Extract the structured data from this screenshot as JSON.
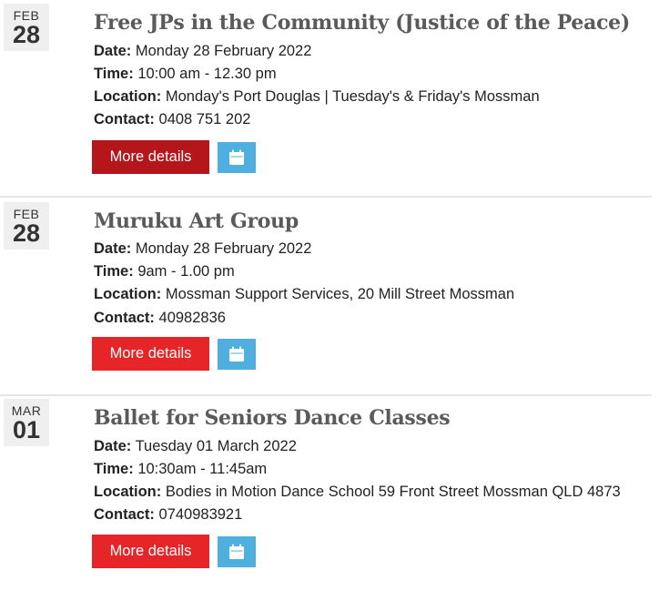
{
  "colors": {
    "button_active": "#b4161c",
    "button": "#e62529",
    "calendar_button": "#4fb0e0",
    "title": "#5a5a5a"
  },
  "events": [
    {
      "month": "FEB",
      "day": "28",
      "title": "Free JPs in the Community (Justice of the Peace)",
      "date_label": "Date:",
      "date": "Monday 28 February 2022",
      "time_label": "Time:",
      "time": "10:00 am - 12.30 pm",
      "location_label": "Location:",
      "location": "Monday's Port Douglas | Tuesday's & Friday's Mossman",
      "contact_label": "Contact:",
      "contact": "0408 751 202",
      "more_label": "More details",
      "calendar_icon": "calendar-icon"
    },
    {
      "month": "FEB",
      "day": "28",
      "title": "Muruku Art Group",
      "date_label": "Date:",
      "date": "Monday 28 February 2022",
      "time_label": "Time:",
      "time": "9am - 1.00 pm",
      "location_label": "Location:",
      "location": "Mossman Support Services, 20 Mill Street Mossman",
      "contact_label": "Contact:",
      "contact": "40982836",
      "more_label": "More details",
      "calendar_icon": "calendar-icon"
    },
    {
      "month": "MAR",
      "day": "01",
      "title": "Ballet for Seniors Dance Classes",
      "date_label": "Date:",
      "date": "Tuesday 01 March 2022",
      "time_label": "Time:",
      "time": "10:30am - 11:45am",
      "location_label": "Location:",
      "location": "Bodies in Motion Dance School 59 Front Street Mossman QLD 4873",
      "contact_label": "Contact:",
      "contact": "0740983921",
      "more_label": "More details",
      "calendar_icon": "calendar-icon"
    }
  ]
}
